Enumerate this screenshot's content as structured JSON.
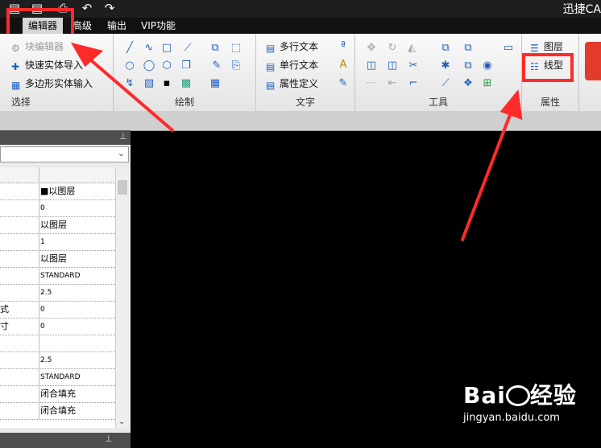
{
  "app_title": "迅捷CA",
  "menu": {
    "tabs": [
      "编辑器",
      "高级",
      "输出",
      "VIP功能"
    ]
  },
  "ribbon": {
    "select": {
      "label": "选择",
      "items": [
        "块编辑器",
        "快速实体导入",
        "多边形实体输入"
      ]
    },
    "draw": {
      "label": "绘制"
    },
    "text": {
      "label": "文字",
      "items": [
        "多行文本",
        "单行文本",
        "属性定义"
      ]
    },
    "tools": {
      "label": "工具"
    },
    "props": {
      "label": "属性",
      "items": [
        "图层",
        "线型"
      ]
    }
  },
  "properties": {
    "rows": [
      {
        "key": "",
        "value": "■以图层"
      },
      {
        "key": "",
        "value": "0"
      },
      {
        "key": "",
        "value": "以图层"
      },
      {
        "key": "",
        "value": "1"
      },
      {
        "key": "",
        "value": "以图层"
      },
      {
        "key": "",
        "value": "STANDARD"
      },
      {
        "key": "",
        "value": "2.5"
      },
      {
        "key": "式",
        "value": "0"
      },
      {
        "key": "寸",
        "value": "0"
      },
      {
        "key": "",
        "value": ""
      },
      {
        "key": "",
        "value": "2.5"
      },
      {
        "key": "",
        "value": "STANDARD"
      },
      {
        "key": "",
        "value": "闭合填充"
      },
      {
        "key": "",
        "value": "闭合填充"
      }
    ]
  },
  "watermark": {
    "brand": "Bai",
    "brand2": "经验",
    "url": "jingyan.baidu.com"
  },
  "colors": {
    "annotation_red": "#ff2a2a",
    "ribbon_bg": "#eeeeee",
    "canvas_bg": "#000000"
  }
}
